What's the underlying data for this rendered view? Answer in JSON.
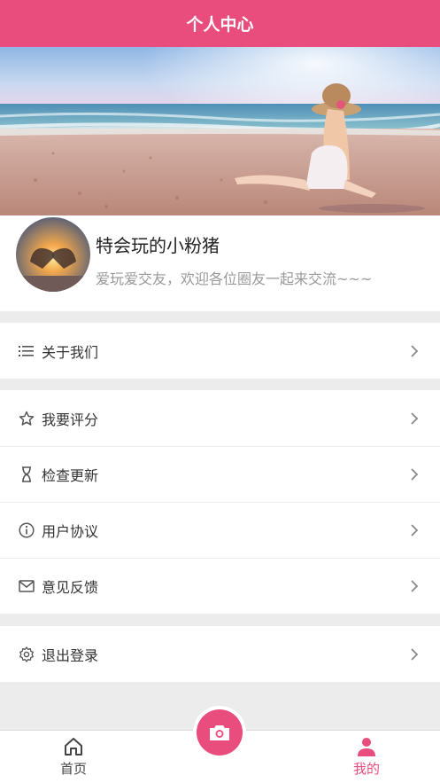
{
  "header": {
    "title": "个人中心"
  },
  "profile": {
    "nickname": "特会玩的小粉猪",
    "bio": "爱玩爱交友，欢迎各位圈友一起来交流~~~"
  },
  "menu_groups": [
    {
      "items": [
        {
          "label": "关于我们",
          "icon": "list-icon"
        }
      ]
    },
    {
      "items": [
        {
          "label": "我要评分",
          "icon": "star-icon"
        },
        {
          "label": "检查更新",
          "icon": "hourglass-icon"
        },
        {
          "label": "用户协议",
          "icon": "info-icon"
        },
        {
          "label": "意见反馈",
          "icon": "mail-icon"
        }
      ]
    },
    {
      "items": [
        {
          "label": "退出登录",
          "icon": "gear-icon"
        }
      ]
    }
  ],
  "tabbar": {
    "home_label": "首页",
    "mine_label": "我的",
    "active": "mine"
  },
  "colors": {
    "accent": "#e94d7d"
  }
}
